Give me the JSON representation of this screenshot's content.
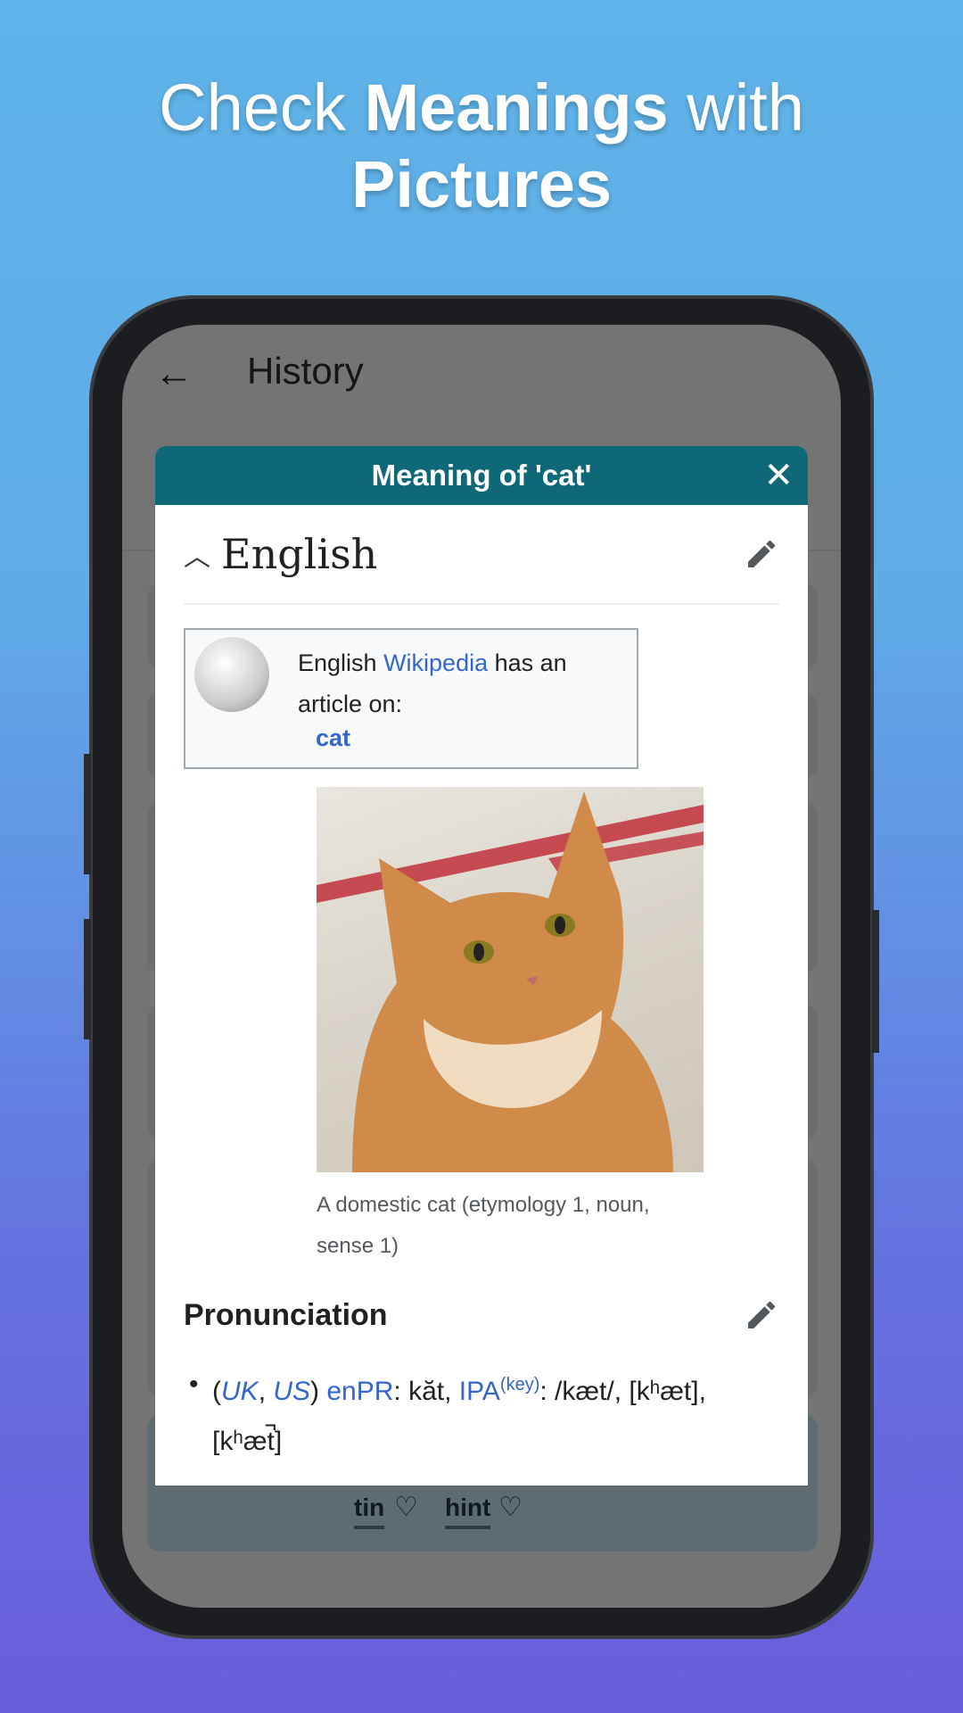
{
  "headline": {
    "part1": "Check ",
    "bold1": "Meanings",
    "part2": " with",
    "bold2": "Pictures"
  },
  "app": {
    "title": "History",
    "back_icon": "arrow-left",
    "tabs": [
      "history-icon",
      "heart-icon"
    ],
    "words": [
      "tin",
      "hint"
    ]
  },
  "dialog": {
    "title": "Meaning of 'cat'",
    "close": "✕",
    "language": "English",
    "wiki": {
      "pre": "English ",
      "link": "Wikipedia",
      "post": " has an article on:",
      "target": "cat"
    },
    "caption": "A domestic cat (etymology 1, noun, sense 1)",
    "pronunciation": {
      "heading": "Pronunciation",
      "uk": "UK",
      "us": "US",
      "enpr": "enPR",
      "enpr_val": ": kăt, ",
      "ipa": "IPA",
      "key": "(key)",
      "ipa_val": ": /kæt/, [kʰæt], [kʰæt̚]"
    }
  },
  "colors": {
    "header": "#0f6878",
    "link": "#3366cc"
  }
}
